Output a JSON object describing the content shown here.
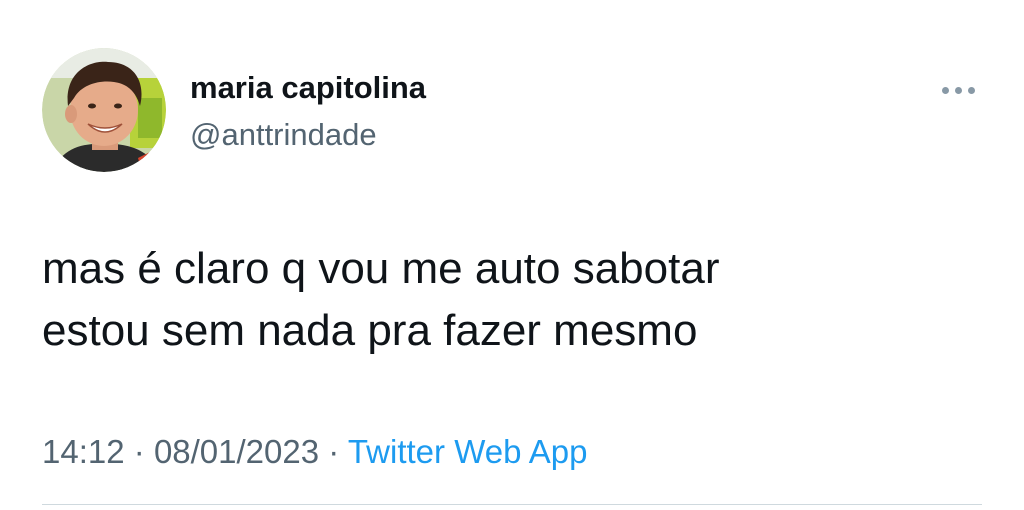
{
  "author": {
    "display_name": "maria capitolina",
    "handle": "@anttrindade"
  },
  "tweet": {
    "lines": [
      "mas é claro q vou me auto sabotar",
      "estou sem nada pra fazer mesmo"
    ],
    "time": "14:12",
    "separator": "·",
    "date": "08/01/2023",
    "source": "Twitter Web App"
  },
  "icons": {
    "more": "more-options-icon",
    "avatar": "profile-photo"
  },
  "colors": {
    "text": "#0f1419",
    "secondary": "#536471",
    "link": "#1d9bf0",
    "divider": "#cfd9de"
  }
}
